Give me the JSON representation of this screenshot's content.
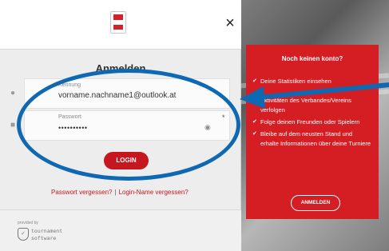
{
  "modal": {
    "title": "Anmelden",
    "close_label": "×",
    "username": {
      "label": "Kennung",
      "value": "vorname.nachname1@outlook.at"
    },
    "password": {
      "label": "Passwort",
      "value": "••••••••••",
      "required_mark": "*"
    },
    "login_button": "LOGIN",
    "forgot_password": "Passwort vergessen?",
    "separator": "|",
    "forgot_login": "Login-Name vergessen?",
    "footer": {
      "provided_by": "provided by",
      "brand_line1": "tournament",
      "brand_line2": "software"
    }
  },
  "info_panel": {
    "title": "Noch keinen konto?",
    "items": [
      "Deine Statistiken einsehen",
      "Aktivitäten des Verbandes/Vereins verfolgen",
      "Folge deinen Freunden oder Spielern",
      "Bleibe auf dem neusten Stand und erhalte Informationen über deine Turniere"
    ],
    "register_button": "ANMELDEN"
  },
  "colors": {
    "accent_red": "#c6161f",
    "panel_red": "#d51d24",
    "annotation_blue": "#0f69b2"
  },
  "icons": [
    "logo-icon",
    "close-icon",
    "user-icon",
    "lock-icon",
    "eye-icon",
    "check-icon",
    "tournament-software-icon"
  ]
}
